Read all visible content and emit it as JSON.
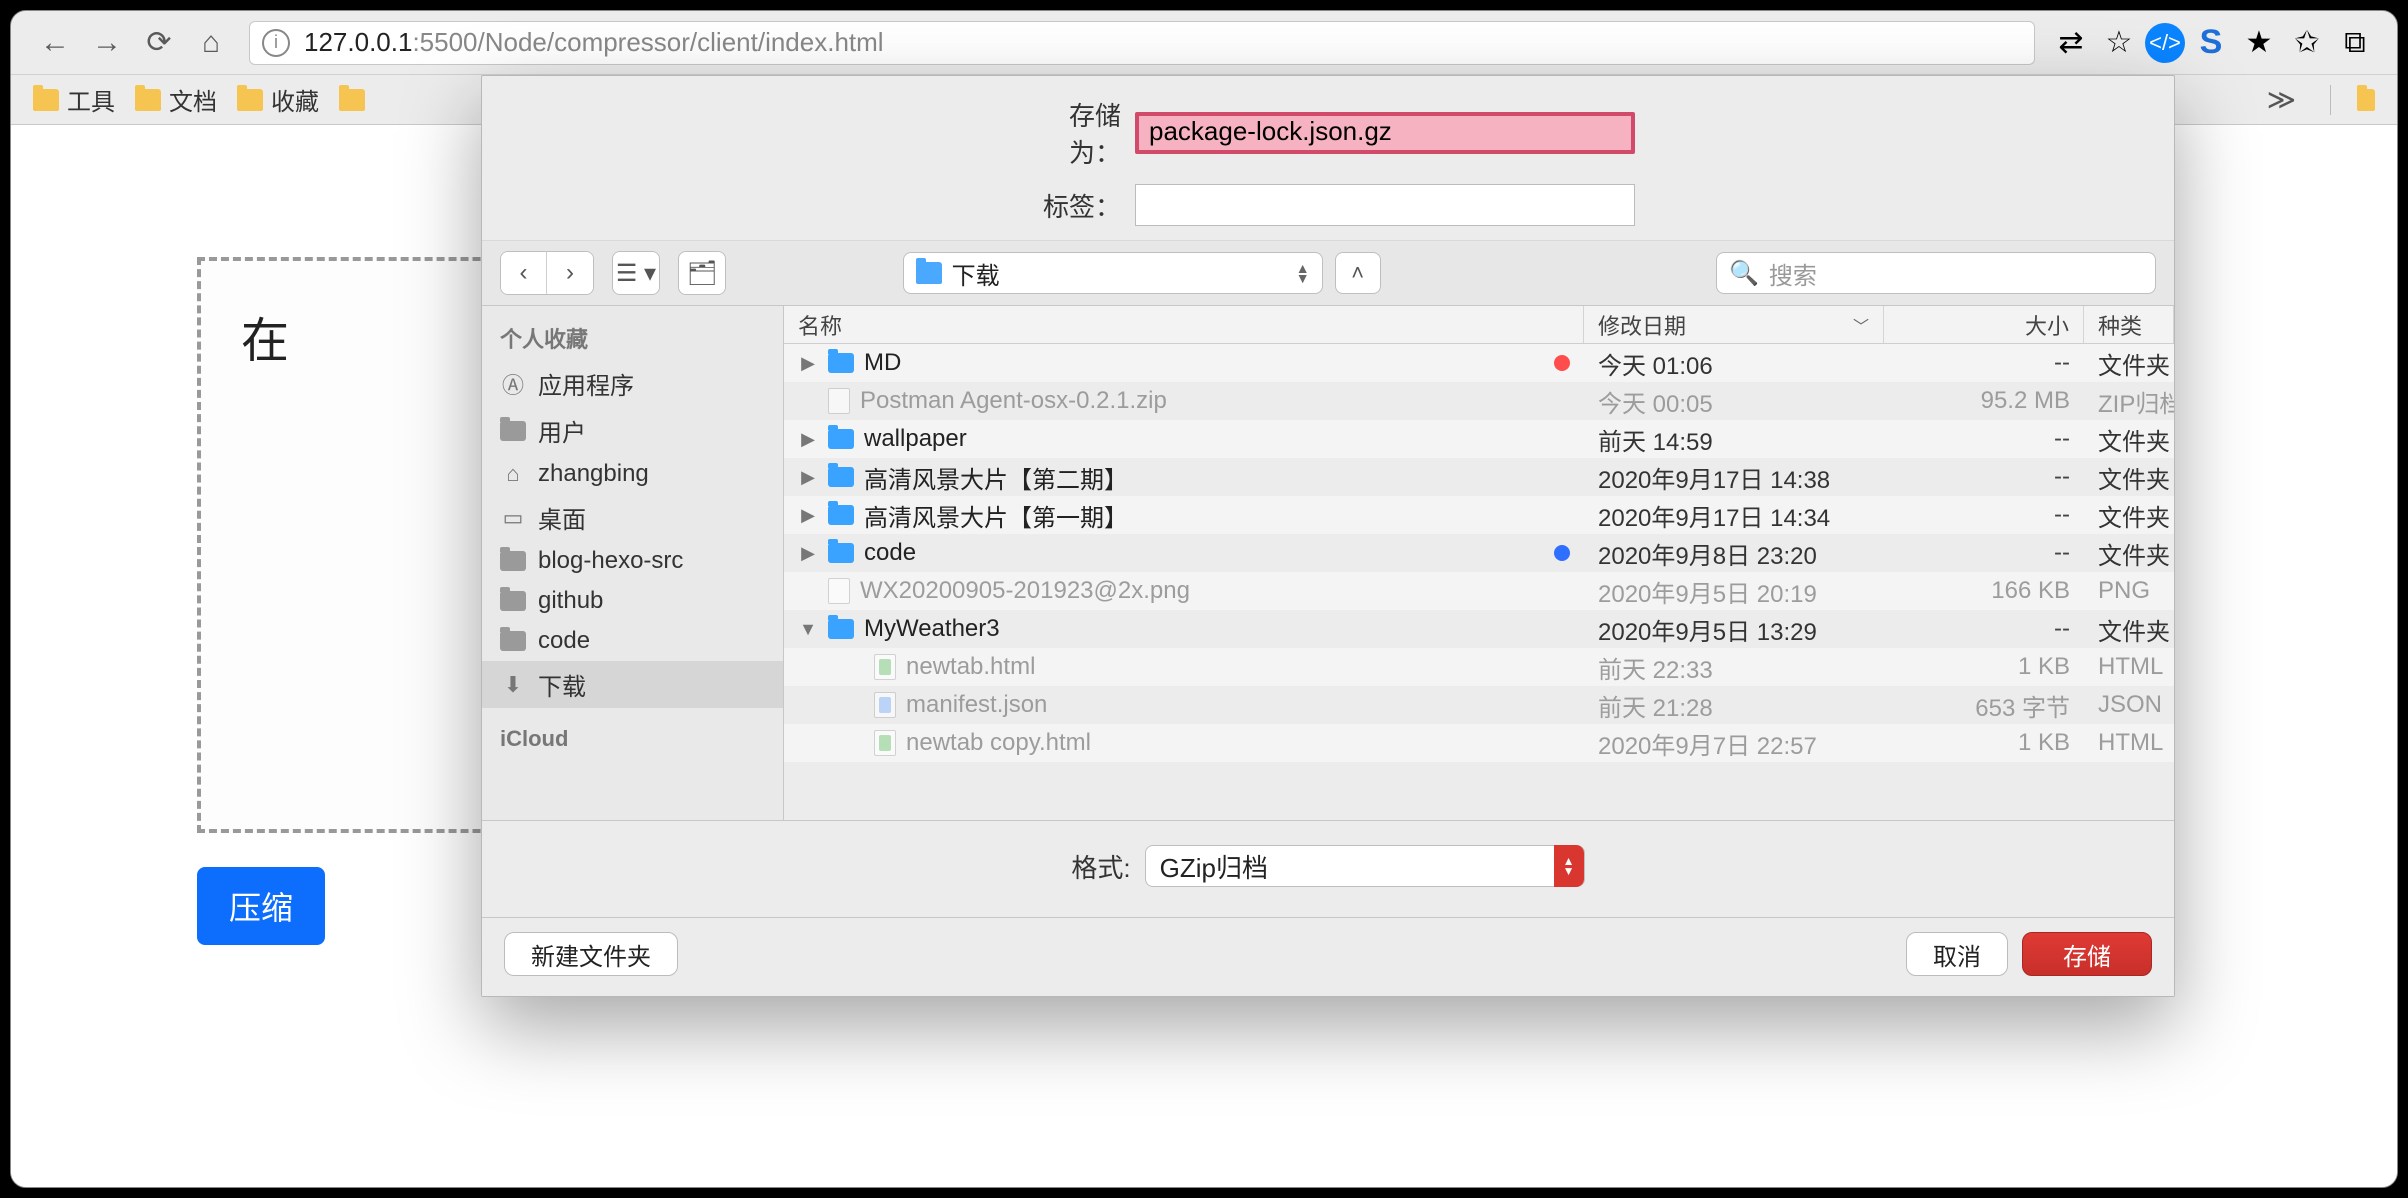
{
  "browser": {
    "url_host": "127.0.0.1",
    "url_path": ":5500/Node/compressor/client/index.html",
    "bookmarks": [
      "工具",
      "文档",
      "收藏"
    ]
  },
  "page": {
    "dropzone_text_prefix": "在",
    "compress_button": "压缩"
  },
  "dialog": {
    "save_as_label": "存储为：",
    "save_as_value": "package-lock.json.gz",
    "tags_label": "标签：",
    "location": "下载",
    "search_placeholder": "搜索",
    "format_label": "格式:",
    "format_value": "GZip归档",
    "new_folder": "新建文件夹",
    "cancel": "取消",
    "save": "存储",
    "sidebar": {
      "favorites_header": "个人收藏",
      "icloud_header": "iCloud",
      "items": [
        {
          "label": "应用程序",
          "icon": "apps"
        },
        {
          "label": "用户",
          "icon": "folder"
        },
        {
          "label": "zhangbing",
          "icon": "home"
        },
        {
          "label": "桌面",
          "icon": "desktop"
        },
        {
          "label": "blog-hexo-src",
          "icon": "folder"
        },
        {
          "label": "github",
          "icon": "folder"
        },
        {
          "label": "code",
          "icon": "folder"
        },
        {
          "label": "下载",
          "icon": "download",
          "selected": true
        }
      ]
    },
    "columns": {
      "name": "名称",
      "date": "修改日期",
      "size": "大小",
      "kind": "种类"
    },
    "files": [
      {
        "disclosure": "▶",
        "icon": "folder",
        "name": "MD",
        "tag": "red",
        "date": "今天 01:06",
        "size": "--",
        "kind": "文件夹",
        "dim": false
      },
      {
        "disclosure": "",
        "icon": "doc",
        "name": "Postman Agent-osx-0.2.1.zip",
        "date": "今天 00:05",
        "size": "95.2 MB",
        "kind": "ZIP归档",
        "dim": true
      },
      {
        "disclosure": "▶",
        "icon": "folder",
        "name": "wallpaper",
        "date": "前天 14:59",
        "size": "--",
        "kind": "文件夹",
        "dim": false
      },
      {
        "disclosure": "▶",
        "icon": "folder",
        "name": "高清风景大片【第二期】",
        "date": "2020年9月17日 14:38",
        "size": "--",
        "kind": "文件夹",
        "dim": false
      },
      {
        "disclosure": "▶",
        "icon": "folder",
        "name": "高清风景大片【第一期】",
        "date": "2020年9月17日 14:34",
        "size": "--",
        "kind": "文件夹",
        "dim": false
      },
      {
        "disclosure": "▶",
        "icon": "folder",
        "name": "code",
        "tag": "blue",
        "date": "2020年9月8日 23:20",
        "size": "--",
        "kind": "文件夹",
        "dim": false
      },
      {
        "disclosure": "",
        "icon": "doc",
        "name": "WX20200905-201923@2x.png",
        "date": "2020年9月5日 20:19",
        "size": "166 KB",
        "kind": "PNG",
        "dim": true
      },
      {
        "disclosure": "▼",
        "icon": "folder",
        "name": "MyWeather3",
        "date": "2020年9月5日 13:29",
        "size": "--",
        "kind": "文件夹",
        "dim": false
      },
      {
        "disclosure": "",
        "icon": "doc-green",
        "name": "newtab.html",
        "child": true,
        "date": "前天 22:33",
        "size": "1 KB",
        "kind": "HTML",
        "dim": true
      },
      {
        "disclosure": "",
        "icon": "doc-blue",
        "name": "manifest.json",
        "child": true,
        "date": "前天 21:28",
        "size": "653 字节",
        "kind": "JSON",
        "dim": true
      },
      {
        "disclosure": "",
        "icon": "doc-green",
        "name": "newtab copy.html",
        "child": true,
        "date": "2020年9月7日 22:57",
        "size": "1 KB",
        "kind": "HTML",
        "dim": true
      }
    ]
  }
}
